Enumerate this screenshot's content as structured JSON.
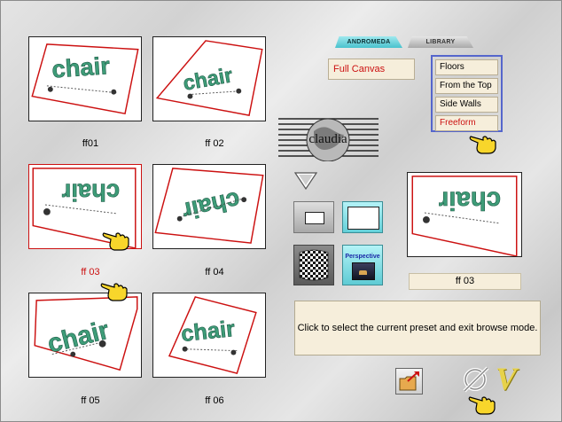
{
  "tabs": [
    {
      "label": "ANDROMEDA",
      "active": true
    },
    {
      "label": "LIBRARY",
      "active": false
    }
  ],
  "canvas_mode": {
    "label": "Full Canvas"
  },
  "menu": {
    "items": [
      {
        "label": "Floors",
        "selected": false
      },
      {
        "label": "From the Top",
        "selected": false
      },
      {
        "label": "Side Walls",
        "selected": false
      },
      {
        "label": "Freeform",
        "selected": true
      }
    ]
  },
  "thumbnails": [
    {
      "label": "ff01",
      "selected": false
    },
    {
      "label": "ff 02",
      "selected": false
    },
    {
      "label": "ff 03",
      "selected": true
    },
    {
      "label": "ff 04",
      "selected": false
    },
    {
      "label": "ff 05",
      "selected": false
    },
    {
      "label": "ff 06",
      "selected": false
    }
  ],
  "thumb_text": "chair",
  "logo_text": "claudia",
  "perspective_label": "Perspective",
  "preview": {
    "name": "ff 03"
  },
  "status": {
    "text": "Click to select the current preset and exit browse mode."
  },
  "accept_glyph": "V",
  "colors": {
    "accent_red": "#cc1111",
    "teal": "#49c2cd",
    "chair_green": "#3e9c78",
    "panel": "#f6eedb",
    "menu_border": "#5566cc"
  }
}
